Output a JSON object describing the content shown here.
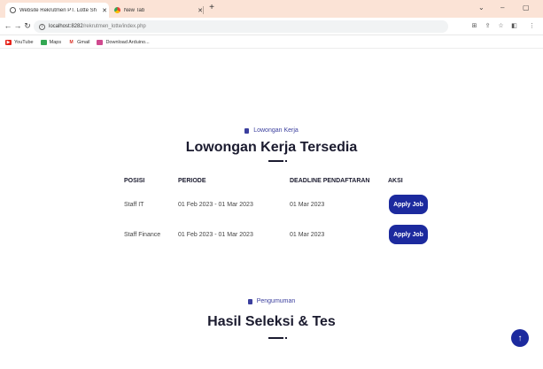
{
  "browser": {
    "tabs": [
      {
        "title": "Website Rekrutmen PT. Lotte Sh",
        "active": true
      },
      {
        "title": "New Tab",
        "active": false
      }
    ],
    "new_tab_label": "+",
    "url_host": "localhost:8282",
    "url_path": "/rekrutmen_lotte/index.php",
    "bookmarks": [
      "YouTube",
      "Maps",
      "Gmail",
      "Download Arduino..."
    ]
  },
  "jobs_section": {
    "kicker": "Lowongan Kerja",
    "title": "Lowongan Kerja Tersedia",
    "columns": [
      "POSISI",
      "PERIODE",
      "DEADLINE PENDAFTARAN",
      "AKSI"
    ],
    "rows": [
      {
        "posisi": "Staff IT",
        "periode": "01 Feb 2023 - 01 Mar 2023",
        "deadline": "01 Mar 2023",
        "action": "Apply Job"
      },
      {
        "posisi": "Staff Finance",
        "periode": "01 Feb 2023 - 01 Mar 2023",
        "deadline": "01 Mar 2023",
        "action": "Apply Job"
      }
    ]
  },
  "announcement_section": {
    "kicker": "Pengumuman",
    "title": "Hasil Seleksi & Tes"
  },
  "colors": {
    "accent": "#1c2a9e",
    "kicker": "#3b3f9e",
    "tab_bar": "#fbe3d6"
  }
}
